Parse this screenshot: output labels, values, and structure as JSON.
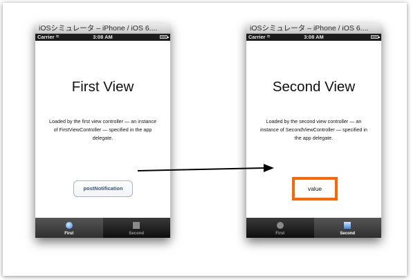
{
  "left_sim": {
    "window_title": "iOSシミュレータ – iPhone / iOS 6....",
    "status": {
      "carrier": "Carrier",
      "time": "3:08 AM"
    },
    "view_title": "First View",
    "description": "Loaded by the first view controller — an instance of FirstViewController — specified in the app delegate.",
    "button_label": "postNotification",
    "tabs": [
      {
        "label": "First",
        "icon": "circle-icon",
        "selected": true
      },
      {
        "label": "Second",
        "icon": "square-icon",
        "selected": false
      }
    ]
  },
  "right_sim": {
    "window_title": "iOSシミュレータ – iPhone / iOS 6....",
    "status": {
      "carrier": "Carrier",
      "time": "3:08 AM"
    },
    "view_title": "Second View",
    "description": "Loaded by the second view controller — an instance of SecondViewController — specified in the app delegate.",
    "value_label": "value",
    "tabs": [
      {
        "label": "First",
        "icon": "circle-icon",
        "selected": false
      },
      {
        "label": "Second",
        "icon": "square-icon",
        "selected": true
      }
    ]
  },
  "colors": {
    "highlight_border": "#ff6600",
    "arrow": "#000000",
    "tab_selected_icon": "#3c87df"
  }
}
